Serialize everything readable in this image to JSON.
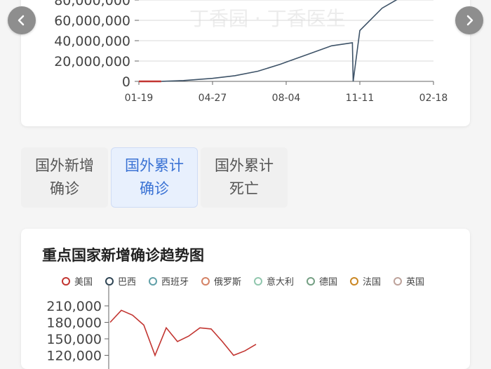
{
  "navigation": {
    "prev_icon": "chevron-left-icon",
    "next_icon": "chevron-right-icon"
  },
  "watermark": "丁香园 · 丁香医生",
  "tabs": [
    {
      "label_line1": "国外新增",
      "label_line2": "确诊",
      "active": false
    },
    {
      "label_line1": "国外累计",
      "label_line2": "确诊",
      "active": true
    },
    {
      "label_line1": "国外累计",
      "label_line2": "死亡",
      "active": false
    }
  ],
  "chart_data": [
    {
      "type": "line",
      "title": "",
      "x_ticks": [
        "01-19",
        "04-27",
        "08-04",
        "11-11",
        "02-18"
      ],
      "y_ticks": [
        "0",
        "20,000,000",
        "40,000,000",
        "60,000,000",
        "80,000,000"
      ],
      "ylim": [
        0,
        80000000
      ],
      "series": [
        {
          "color": "#3e5368",
          "x": [
            "01-19",
            "02-19",
            "03-19",
            "04-27",
            "05-27",
            "06-27",
            "07-27",
            "08-04",
            "09-04",
            "10-04",
            "11-01",
            "11-02",
            "11-11",
            "12-11",
            "01-18"
          ],
          "values": [
            0,
            100000,
            800000,
            3000000,
            5600000,
            10000000,
            16800000,
            19000000,
            27000000,
            35000000,
            38000000,
            0,
            50000000,
            72000000,
            88000000
          ]
        },
        {
          "color": "#c23531",
          "x": [
            "01-19",
            "02-18"
          ],
          "values": [
            0,
            0
          ]
        }
      ],
      "grid": true
    },
    {
      "type": "line",
      "title": "重点国家新增确诊趋势图",
      "legend_position": "top",
      "y_ticks": [
        "150,000",
        "180,000",
        "210,000"
      ],
      "ylim": [
        130000,
        220000
      ],
      "series": [
        {
          "name": "美国",
          "color": "#c23531",
          "values": [
            180000,
            202000,
            193000,
            175000,
            120000,
            170000,
            145000,
            155000,
            170000,
            168000,
            145000,
            120000,
            128000,
            140000
          ]
        },
        {
          "name": "巴西",
          "color": "#2f4554",
          "values": []
        },
        {
          "name": "西班牙",
          "color": "#61a0a8",
          "values": []
        },
        {
          "name": "俄罗斯",
          "color": "#d48265",
          "values": []
        },
        {
          "name": "意大利",
          "color": "#91c7ae",
          "values": []
        },
        {
          "name": "德国",
          "color": "#749f83",
          "values": []
        },
        {
          "name": "法国",
          "color": "#ca8622",
          "values": []
        },
        {
          "name": "英国",
          "color": "#bda29a",
          "values": []
        }
      ],
      "partial_tick": "120,000"
    }
  ]
}
